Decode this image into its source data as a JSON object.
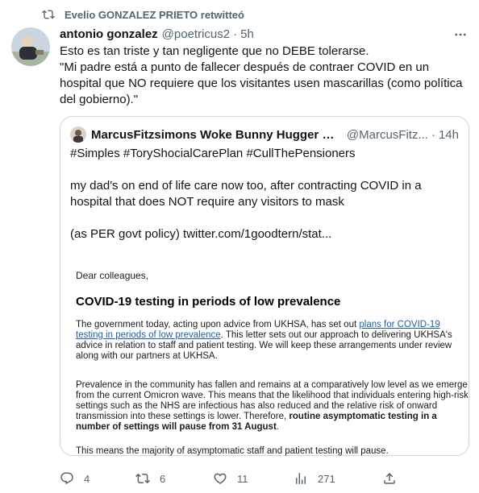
{
  "retweet_context": "Evelio GONZALEZ PRIETO retwitteó",
  "tweet": {
    "author_name": "antonio gonzalez",
    "author_handle": "@poetricus2",
    "separator": "·",
    "time": "5h",
    "text_line1": "Esto es tan triste y tan negligente que no DEBE tolerarse.",
    "text_line2": "\"Mi padre está a punto de fallecer  después de contraer COVID en un hospital que NO requiere que los visitantes usen mascarillas (como política del gobierno).\""
  },
  "quoted": {
    "author_name": "MarcusFitzsimons Woke Bunny Hugger Gre...",
    "author_handle": "@MarcusFitz...",
    "separator": "·",
    "time": "14h",
    "hashtags": "#Simples #ToryShocialCarePlan #CullThePensioners",
    "para1": "my dad's on end of life care now too, after contracting COVID in a hospital that does NOT require any visitors to mask",
    "para2": "(as PER govt policy)  twitter.com/1goodtern/stat..."
  },
  "letter": {
    "greeting": "Dear colleagues,",
    "title": "COVID-19 testing in periods of low prevalence",
    "p1_before": "The government today, acting upon advice from UKHSA, has set out ",
    "p1_link": "plans for COVID-19 testing in periods of low prevalence",
    "p1_after": ". This letter sets out our approach to delivering UKHSA's advice in relation to staff and patient testing. We will keep these arrangements under review along with our partners at UKHSA.",
    "p2_before": "Prevalence in the community has fallen and remains at a comparatively low level as we emerge from the current Omicron wave. This means that the likelihood that individuals entering high-risk settings such as the NHS are infectious has also reduced and the relative risk of onward transmission into these settings is lower. Therefore, ",
    "p2_bold": "routine asymptomatic testing in a number of settings will pause from 31 August",
    "p2_after": ".",
    "p3": "This means the majority of asymptomatic staff and patient testing will pause."
  },
  "actions": {
    "reply_count": "4",
    "retweet_count": "6",
    "like_count": "11",
    "views_count": "271"
  },
  "colors": {
    "secondary_text": "#536471",
    "border": "#cfd9de",
    "link": "#1d5fa8"
  }
}
